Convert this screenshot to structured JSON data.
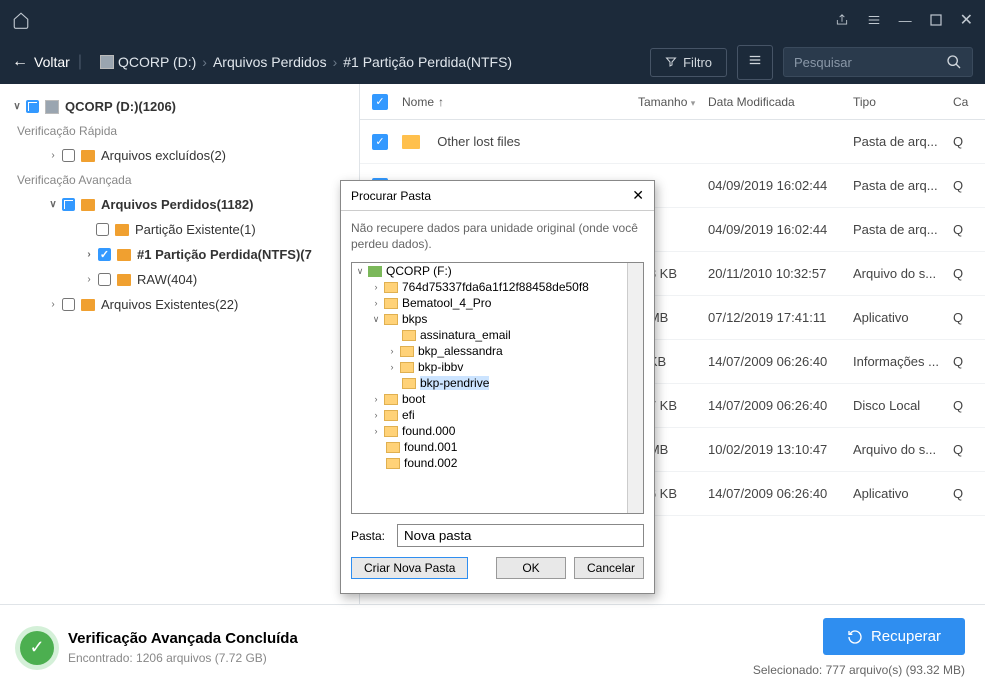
{
  "titlebar": {},
  "toolbar": {
    "back": "Voltar",
    "filter": "Filtro",
    "search_placeholder": "Pesquisar"
  },
  "breadcrumb": {
    "drive": "QCORP (D:)",
    "p1": "Arquivos Perdidos",
    "p2": "#1 Partição Perdida(NTFS)"
  },
  "sidebar": {
    "root": "QCORP (D:)(1206)",
    "quick_section": "Verificação Rápida",
    "excluded": "Arquivos excluídos(2)",
    "adv_section": "Verificação Avançada",
    "lost": "Arquivos Perdidos(1182)",
    "existing_part": "Partição Existente(1)",
    "lost_part": "#1 Partição Perdida(NTFS)(7",
    "raw": "RAW(404)",
    "existing": "Arquivos Existentes(22)"
  },
  "table": {
    "h_name": "Nome",
    "h_size": "Tamanho",
    "h_date": "Data Modificada",
    "h_type": "Tipo",
    "rows": [
      {
        "name": "Other lost files",
        "size": "",
        "date": "",
        "type": "Pasta de arq...",
        "c": "Q"
      },
      {
        "name": "",
        "size": "",
        "date": "04/09/2019 16:02:44",
        "type": "Pasta de arq...",
        "c": "Q"
      },
      {
        "name": "",
        "size": "",
        "date": "04/09/2019 16:02:44",
        "type": "Pasta de arq...",
        "c": "Q"
      },
      {
        "name": "",
        "size": ".88 KB",
        "date": "20/11/2010 10:32:57",
        "type": "Arquivo do s...",
        "c": "Q"
      },
      {
        "name": "",
        "size": "5 MB",
        "date": "07/12/2019 17:41:11",
        "type": "Aplicativo",
        "c": "Q"
      },
      {
        "name": "",
        "size": "4 KB",
        "date": "14/07/2009 06:26:40",
        "type": "Informações ...",
        "c": "Q"
      },
      {
        "name": "",
        "size": ".57 KB",
        "date": "14/07/2009 06:26:40",
        "type": "Disco Local",
        "c": "Q"
      },
      {
        "name": "",
        "size": "0 MB",
        "date": "10/02/2019 13:10:47",
        "type": "Arquivo do s...",
        "c": "Q"
      },
      {
        "name": "",
        "size": ".26 KB",
        "date": "14/07/2009 06:26:40",
        "type": "Aplicativo",
        "c": "Q"
      }
    ]
  },
  "dialog": {
    "title": "Procurar Pasta",
    "msg": "Não recupere dados para unidade original (onde você perdeu dados).",
    "drive": "QCORP (F:)",
    "items": {
      "i1": "764d75337fda6a1f12f88458de50f8",
      "i2": "Bematool_4_Pro",
      "i3": "bkps",
      "i3a": "assinatura_email",
      "i3b": "bkp_alessandra",
      "i3c": "bkp-ibbv",
      "i3d": "bkp-pendrive",
      "i4": "boot",
      "i5": "efi",
      "i6": "found.000",
      "i7": "found.001",
      "i8": "found.002"
    },
    "input_label": "Pasta:",
    "input_value": "Nova pasta",
    "btn_new": "Criar Nova Pasta",
    "btn_ok": "OK",
    "btn_cancel": "Cancelar"
  },
  "footer": {
    "title": "Verificação Avançada Concluída",
    "subtitle": "Encontrado: 1206 arquivos (7.72 GB)",
    "recover": "Recuperar",
    "selected": "Selecionado: 777 arquivo(s) (93.32 MB)"
  }
}
